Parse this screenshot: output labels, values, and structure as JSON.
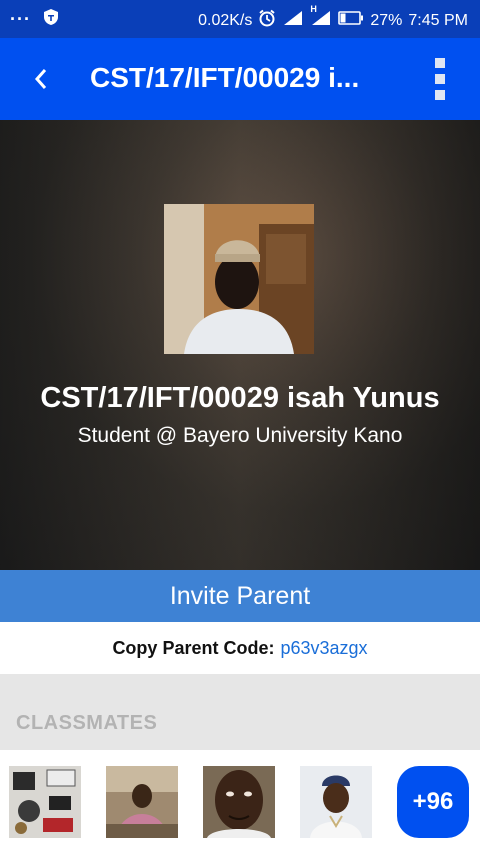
{
  "status_bar": {
    "net_speed": "0.02K/s",
    "battery": "27%",
    "time": "7:45 PM",
    "signal_label": "H"
  },
  "app_bar": {
    "title": "CST/17/IFT/00029 i..."
  },
  "profile": {
    "name": "CST/17/IFT/00029 isah Yunus",
    "role": "Student @ Bayero University Kano"
  },
  "invite": {
    "label": "Invite Parent"
  },
  "parent_code": {
    "label": "Copy Parent Code:",
    "value": "p63v3azgx"
  },
  "classmates": {
    "header": "CLASSMATES",
    "more_label": "+96"
  },
  "colors": {
    "status_bar": "#0a3fb8",
    "app_bar": "#0050f0",
    "invite_button": "#3e82d4",
    "link": "#1a6ed8"
  }
}
